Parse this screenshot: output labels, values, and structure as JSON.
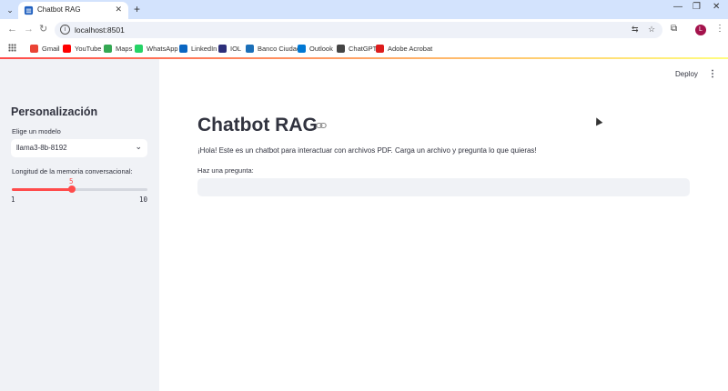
{
  "browser": {
    "tab_title": "Chatbot RAG",
    "url": "localhost:8501",
    "bookmarks": [
      {
        "label": "Gmail",
        "icon": "gmail-icon",
        "color": "#ea4335"
      },
      {
        "label": "YouTube",
        "icon": "youtube-icon",
        "color": "#ff0000"
      },
      {
        "label": "Maps",
        "icon": "maps-icon",
        "color": "#34a853"
      },
      {
        "label": "WhatsApp",
        "icon": "whatsapp-icon",
        "color": "#25d366"
      },
      {
        "label": "LinkedIn",
        "icon": "linkedin-icon",
        "color": "#0a66c2"
      },
      {
        "label": "IOL",
        "icon": "iol-icon",
        "color": "#2d2f7a"
      },
      {
        "label": "Banco Ciudad",
        "icon": "banco-ciudad-icon",
        "color": "#1b6fb8"
      },
      {
        "label": "Outlook",
        "icon": "outlook-icon",
        "color": "#0078d4"
      },
      {
        "label": "ChatGPT",
        "icon": "chatgpt-icon",
        "color": "#444444"
      },
      {
        "label": "Adobe Acrobat",
        "icon": "adobe-acrobat-icon",
        "color": "#dd1c1c"
      }
    ],
    "profile_initial": "L"
  },
  "sidebar": {
    "title": "Personalización",
    "model_label": "Elige un modelo",
    "model_value": "llama3-8b-8192",
    "memory_label": "Longitud de la memoria conversacional:",
    "memory_value": "5",
    "memory_min": "1",
    "memory_max": "10",
    "memory_fraction": 0.444
  },
  "main": {
    "deploy_label": "Deploy",
    "title": "Chatbot RAG",
    "intro": "¡Hola! Este es un chatbot para interactuar con archivos PDF. Carga un archivo y pregunta lo que quieras!",
    "question_label": "Haz una pregunta:",
    "question_value": ""
  },
  "colors": {
    "accent": "#ff4b4b",
    "sidebar_bg": "#f0f2f6",
    "text": "#31333f",
    "tab_strip": "#d3e3fd"
  }
}
